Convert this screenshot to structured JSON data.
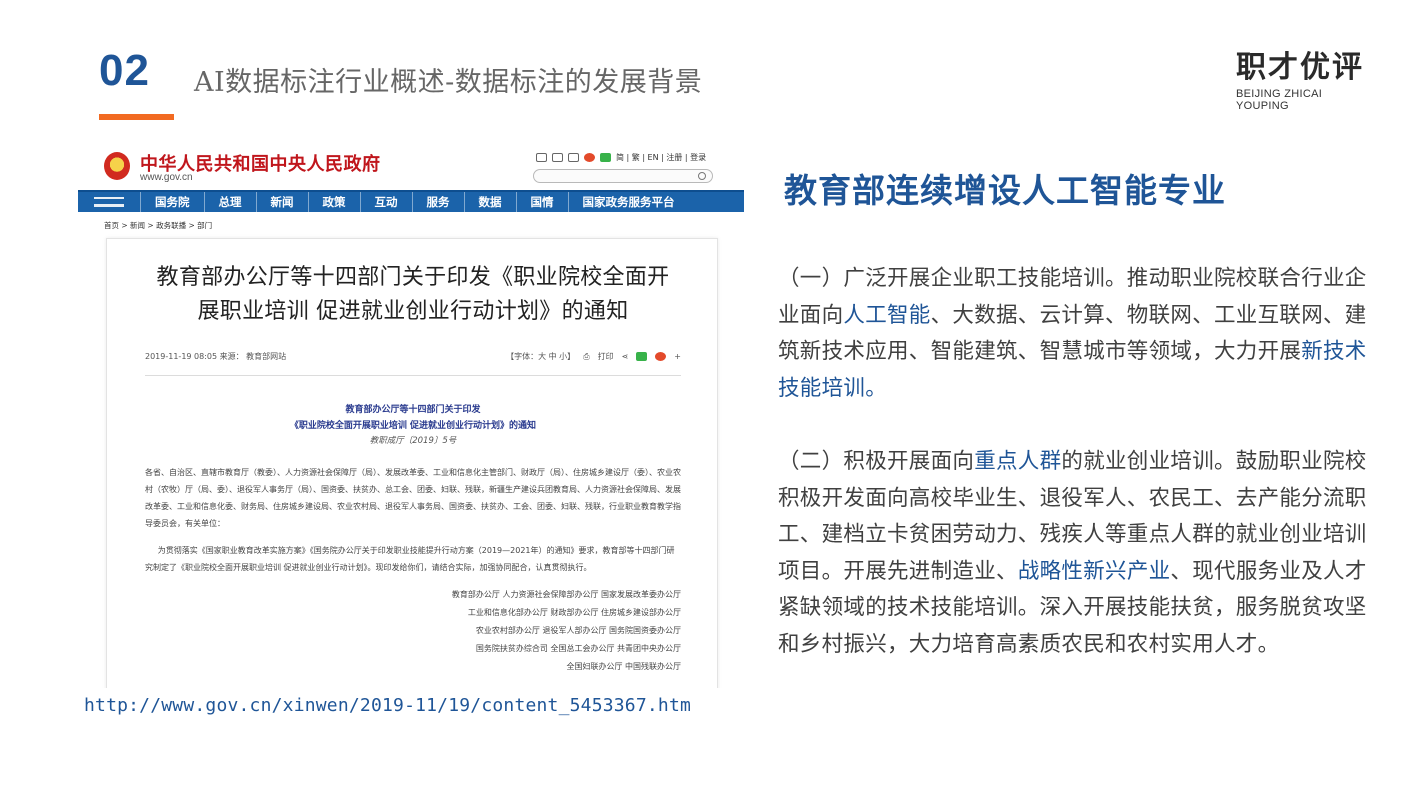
{
  "header": {
    "slide_number": "02",
    "title": "AI数据标注行业概述-数据标注的发展背景"
  },
  "logo": {
    "name_cn": "职才优评",
    "name_en": "BEIJING ZHICAI YOUPING"
  },
  "screenshot": {
    "brand": "中华人民共和国中央人民政府",
    "url": "www.gov.cn",
    "tools": {
      "trad_simp": "简 | 繁 | EN | 注册 | 登录"
    },
    "nav_items": [
      "国务院",
      "总理",
      "新闻",
      "政策",
      "互动",
      "服务",
      "数据",
      "国情",
      "国家政务服务平台"
    ],
    "breadcrumb": "首页 > 新闻 > 政务联播 > 部门",
    "doc_title_line1": "教育部办公厅等十四部门关于印发《职业院校全面开",
    "doc_title_line2": "展职业培训 促进就业创业行动计划》的通知",
    "meta_left": "2019-11-19 08:05   来源： 教育部网站",
    "meta_font": "【字体：大 中 小】",
    "meta_print": "打印",
    "subhead_line1": "教育部办公厅等十四部门关于印发",
    "subhead_line2": "《职业院校全面开展职业培训 促进就业创业行动计划》的通知",
    "doc_number": "教职成厅〔2019〕5号",
    "body_p1": "各省、自治区、直辖市教育厅（教委）、人力资源社会保障厅（局）、发展改革委、工业和信息化主管部门、财政厅（局）、住房城乡建设厅（委）、农业农村（农牧）厅（局、委）、退役军人事务厅（局）、国资委、扶贫办、总工会、团委、妇联、残联，新疆生产建设兵团教育局、人力资源社会保障局、发展改革委、工业和信息化委、财务局、住房城乡建设局、农业农村局、退役军人事务局、国资委、扶贫办、工会、团委、妇联、残联，行业职业教育教学指导委员会，有关单位：",
    "body_p2": "为贯彻落实《国家职业教育改革实施方案》《国务院办公厅关于印发职业技能提升行动方案（2019—2021年）的通知》要求，教育部等十四部门研究制定了《职业院校全面开展职业培训 促进就业创业行动计划》。现印发给你们，请结合实际，加强协同配合，认真贯彻执行。",
    "sign_1": "教育部办公厅  人力资源社会保障部办公厅  国家发展改革委办公厅",
    "sign_2": "工业和信息化部办公厅  财政部办公厅  住房城乡建设部办公厅",
    "sign_3": "农业农村部办公厅  退役军人部办公厅  国务院国资委办公厅",
    "sign_4": "国务院扶贫办综合司  全国总工会办公厅  共青团中央办公厅",
    "sign_5": "全国妇联办公厅  中国残联办公厅"
  },
  "source_url": "http://www.gov.cn/xinwen/2019-11/19/content_5453367.htm",
  "content": {
    "heading": "教育部连续增设人工智能专业",
    "p1_a": "（一）广泛开展企业职工技能培训。推动职业院校联合行业企业面向",
    "p1_hl1": "人工智能",
    "p1_b": "、大数据、云计算、物联网、工业互联网、建筑新技术应用、智能建筑、智慧城市等领域，大力开展",
    "p1_hl2": "新技术技能培训。",
    "p2_a": "（二）积极开展面向",
    "p2_hl1": "重点人群",
    "p2_b": "的就业创业培训。鼓励职业院校积极开发面向高校毕业生、退役军人、农民工、去产能分流职工、建档立卡贫困劳动力、残疾人等重点人群的就业创业培训项目。开展先进制造业、",
    "p2_hl2": "战略性新兴产业",
    "p2_c": "、现代服务业及人才紧缺领域的技术技能培训。深入开展技能扶贫，服务脱贫攻坚和乡村振兴，大力培育高素质农民和农村实用人才。"
  },
  "colors": {
    "accent_blue": "#1f5597",
    "accent_orange": "#f26a21",
    "gov_red": "#c0161c",
    "gov_nav_blue": "#1b63aa"
  }
}
